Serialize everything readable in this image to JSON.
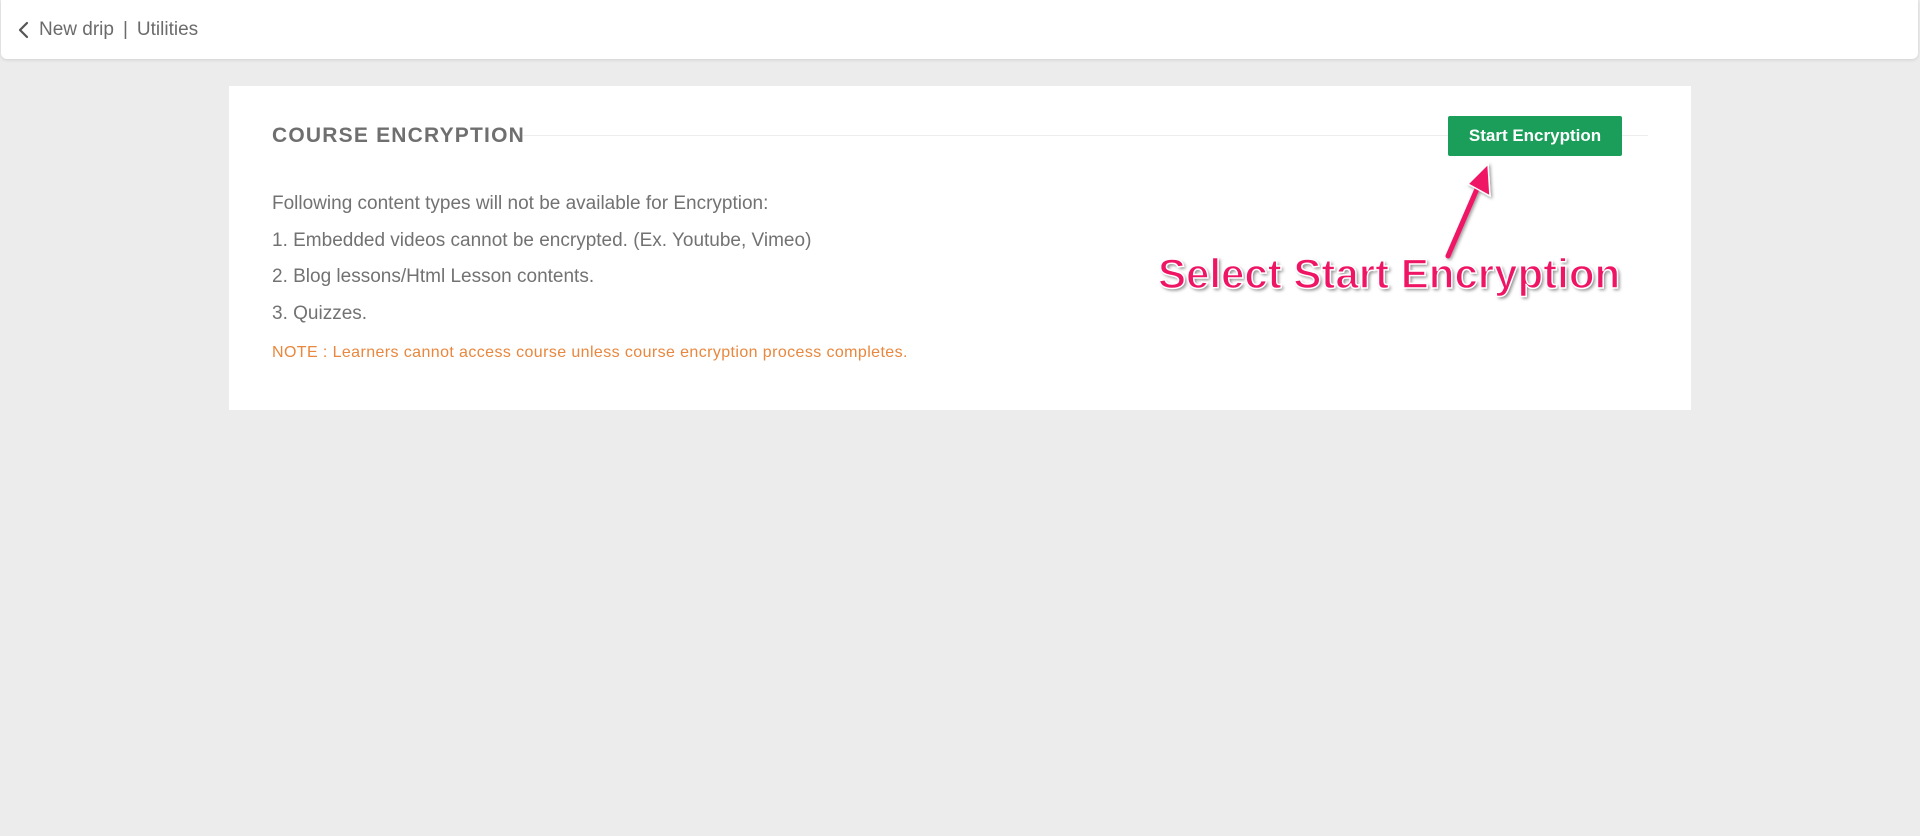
{
  "header": {
    "course_name": "New drip",
    "separator": "|",
    "page_name": "Utilities",
    "back_icon": "chevron-left-icon"
  },
  "section": {
    "title": "COURSE ENCRYPTION",
    "start_button_label": "Start Encryption",
    "intro": "Following content types will not be available for Encryption:",
    "items": [
      "1. Embedded videos cannot be encrypted. (Ex. Youtube, Vimeo)",
      "2. Blog lessons/Html Lesson contents.",
      "3. Quizzes."
    ],
    "note": "NOTE : Learners cannot access course unless course encryption process completes."
  },
  "annotation": {
    "text": "Select Start Encryption"
  },
  "colors": {
    "background": "#ececec",
    "accent_green": "#1b9e5a",
    "note_orange": "#e8873d",
    "annotation_pink": "#ef1565"
  }
}
